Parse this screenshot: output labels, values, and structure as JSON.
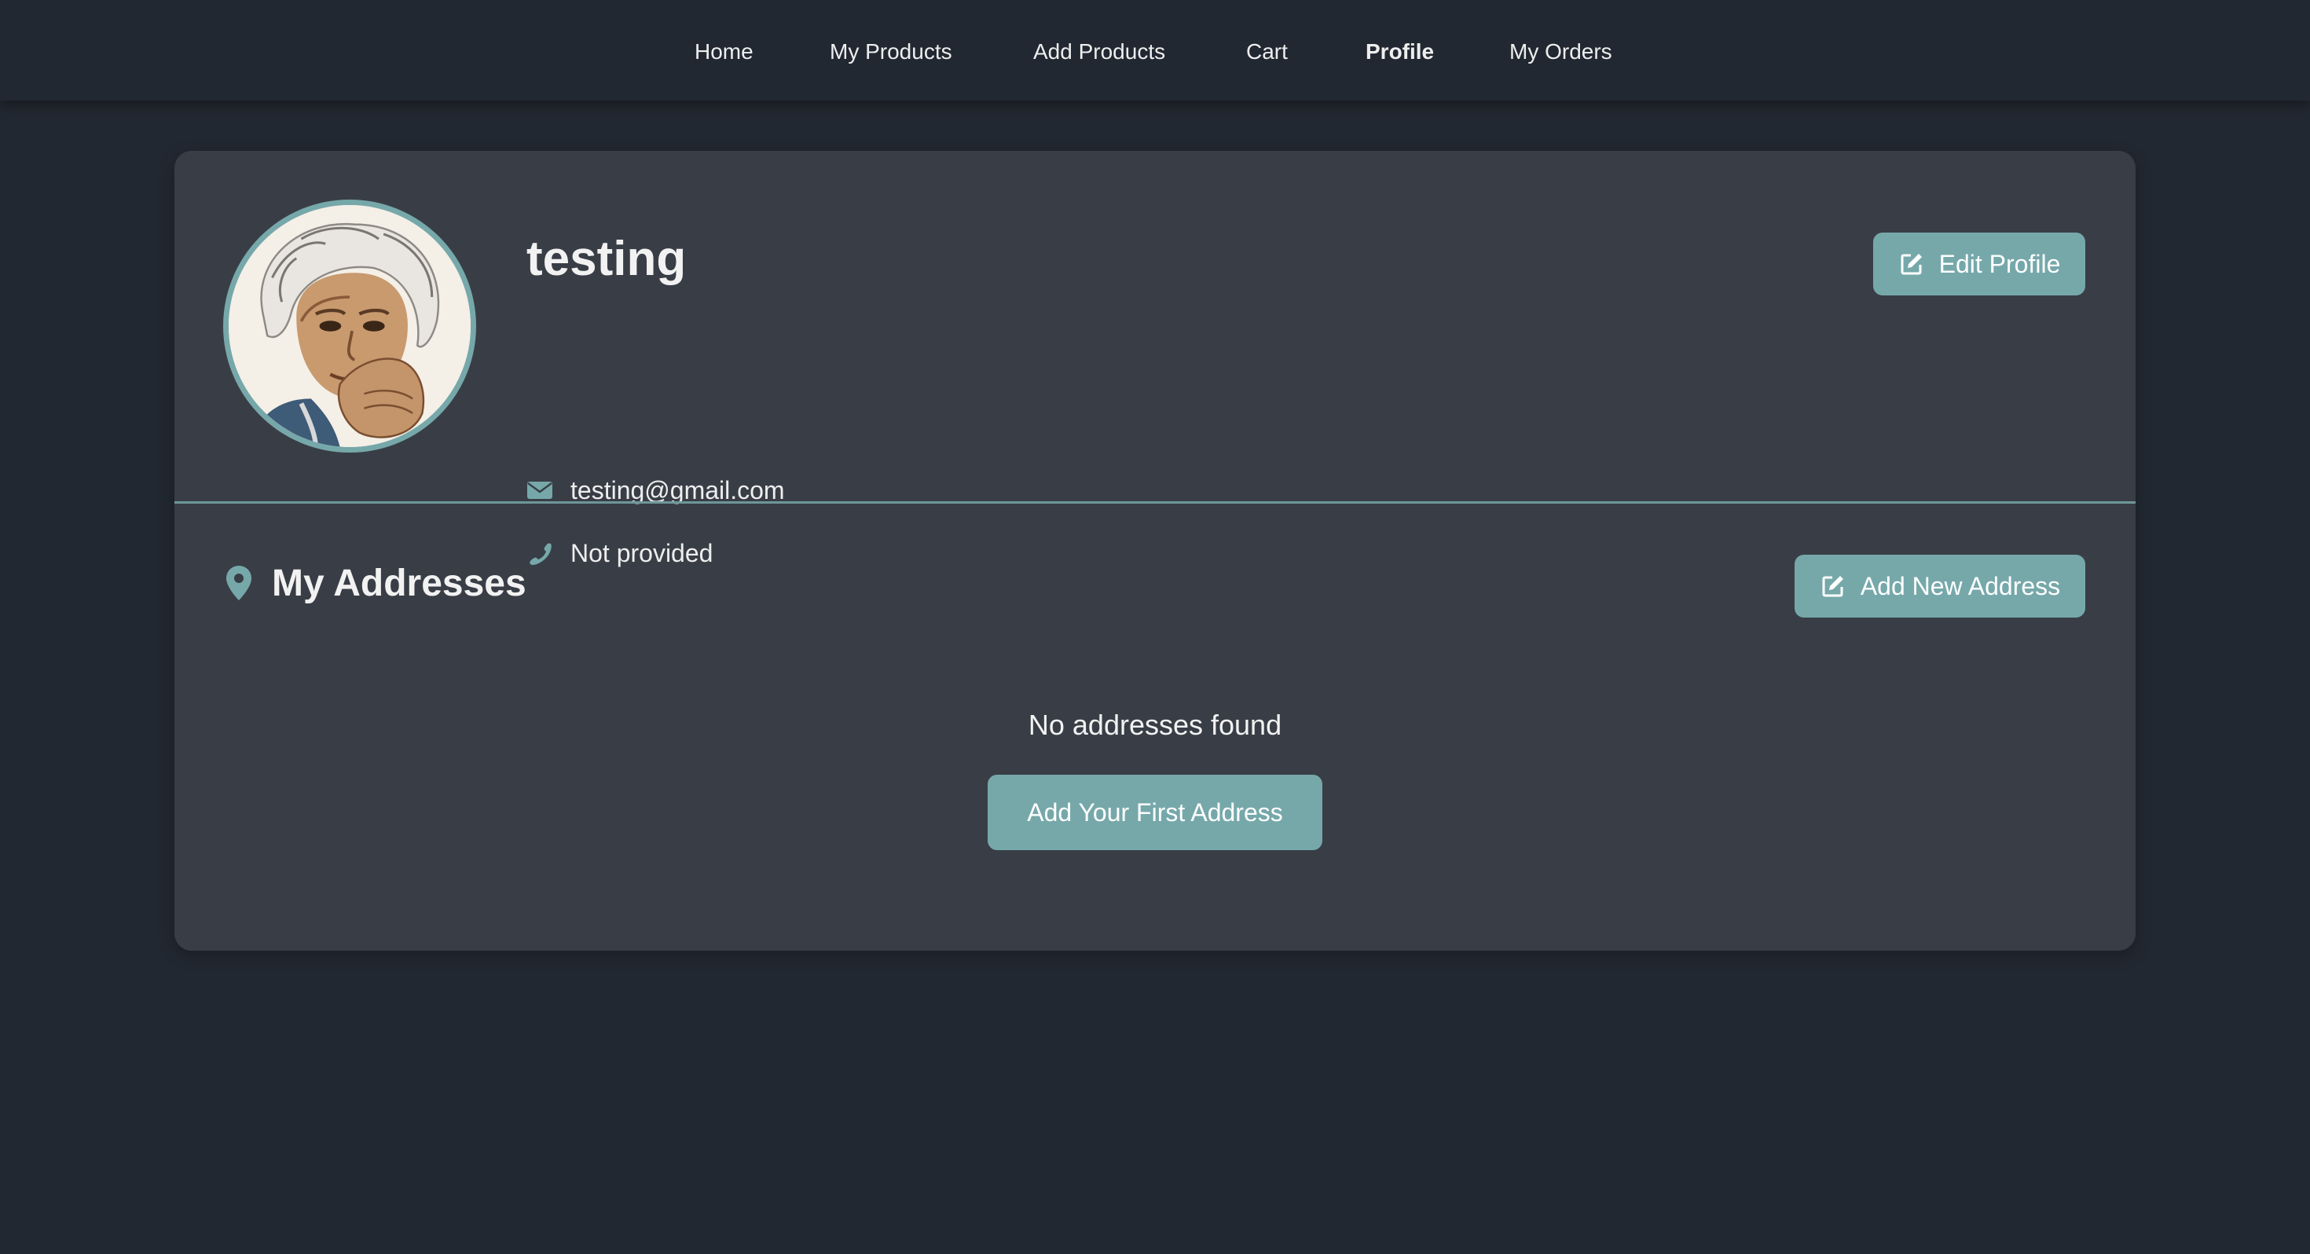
{
  "nav": {
    "items": [
      {
        "label": "Home"
      },
      {
        "label": "My Products"
      },
      {
        "label": "Add Products"
      },
      {
        "label": "Cart"
      },
      {
        "label": "Profile"
      },
      {
        "label": "My Orders"
      }
    ],
    "active": "Profile"
  },
  "profile": {
    "name": "testing",
    "email": "testing@gmail.com",
    "phone": "Not provided",
    "edit_button": "Edit Profile"
  },
  "addresses": {
    "title": "My Addresses",
    "add_button": "Add New Address",
    "empty_message": "No addresses found",
    "first_address_button": "Add Your First Address"
  },
  "icons": {
    "email": "envelope-icon",
    "phone": "phone-icon",
    "address": "map-marker-icon",
    "edit": "edit-icon"
  },
  "colors": {
    "background": "#222831",
    "card": "#393e46",
    "accent": "#76a8aa",
    "text": "#eeeeee"
  }
}
